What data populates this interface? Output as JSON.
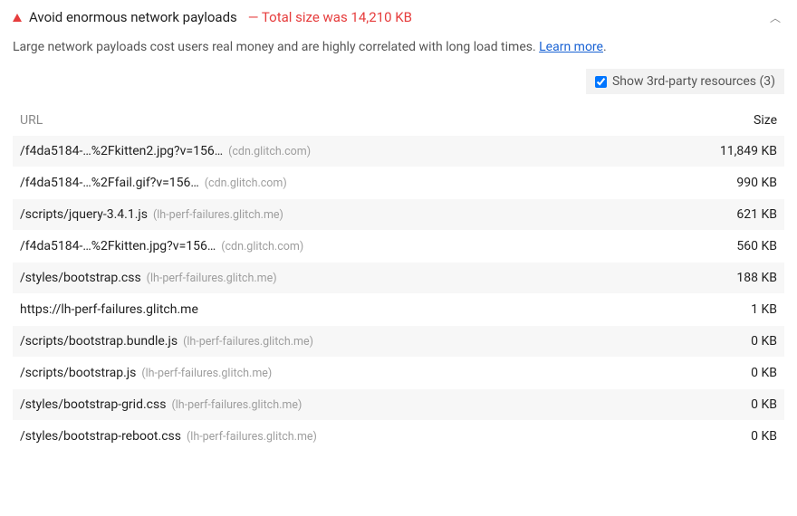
{
  "audit": {
    "title": "Avoid enormous network payloads",
    "subtitle": "— Total size was 14,210 KB",
    "description": "Large network payloads cost users real money and are highly correlated with long load times. ",
    "learn_more": "Learn more",
    "period": "."
  },
  "toggle": {
    "label": "Show 3rd-party resources (3)",
    "checked": true
  },
  "columns": {
    "url": "URL",
    "size": "Size"
  },
  "rows": [
    {
      "url": "/f4da5184-…%2Fkitten2.jpg?v=156…",
      "host": "(cdn.glitch.com)",
      "size": "11,849 KB"
    },
    {
      "url": "/f4da5184-…%2Ffail.gif?v=156…",
      "host": "(cdn.glitch.com)",
      "size": "990 KB"
    },
    {
      "url": "/scripts/jquery-3.4.1.js",
      "host": "(lh-perf-failures.glitch.me)",
      "size": "621 KB"
    },
    {
      "url": "/f4da5184-…%2Fkitten.jpg?v=156…",
      "host": "(cdn.glitch.com)",
      "size": "560 KB"
    },
    {
      "url": "/styles/bootstrap.css",
      "host": "(lh-perf-failures.glitch.me)",
      "size": "188 KB"
    },
    {
      "url": "https://lh-perf-failures.glitch.me",
      "host": "",
      "size": "1 KB"
    },
    {
      "url": "/scripts/bootstrap.bundle.js",
      "host": "(lh-perf-failures.glitch.me)",
      "size": "0 KB"
    },
    {
      "url": "/scripts/bootstrap.js",
      "host": "(lh-perf-failures.glitch.me)",
      "size": "0 KB"
    },
    {
      "url": "/styles/bootstrap-grid.css",
      "host": "(lh-perf-failures.glitch.me)",
      "size": "0 KB"
    },
    {
      "url": "/styles/bootstrap-reboot.css",
      "host": "(lh-perf-failures.glitch.me)",
      "size": "0 KB"
    }
  ]
}
